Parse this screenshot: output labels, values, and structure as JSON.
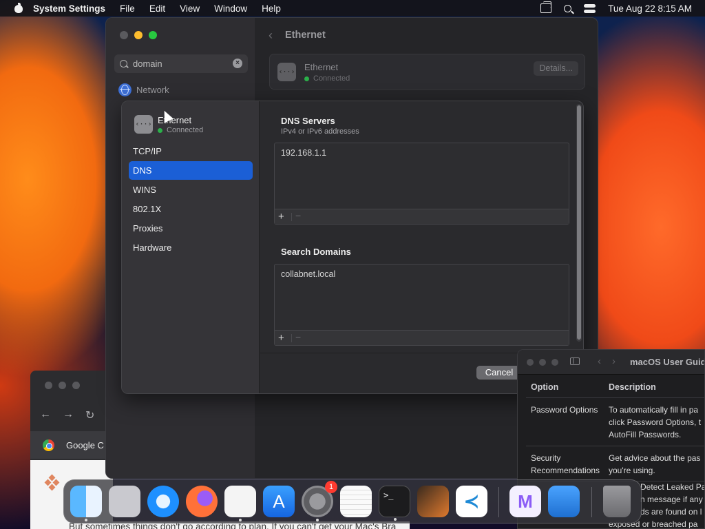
{
  "menubar": {
    "app_name": "System Settings",
    "menus": [
      "File",
      "Edit",
      "View",
      "Window",
      "Help"
    ],
    "datetime": "Tue Aug 22  8:15 AM"
  },
  "settings": {
    "search": {
      "value": "domain",
      "clear_icon": "clear-icon"
    },
    "sidebar_match": "Network",
    "header_title": "Ethernet",
    "ethernet_card": {
      "name": "Ethernet",
      "status": "Connected",
      "details_label": "Details..."
    }
  },
  "dns_sheet": {
    "interface": {
      "name": "Ethernet",
      "status": "Connected"
    },
    "nav": [
      "TCP/IP",
      "DNS",
      "WINS",
      "802.1X",
      "Proxies",
      "Hardware"
    ],
    "selected_nav": "DNS",
    "dns_servers": {
      "title": "DNS Servers",
      "subtitle": "IPv4 or IPv6 addresses",
      "entries": [
        "192.168.1.1"
      ]
    },
    "search_domains": {
      "title": "Search Domains",
      "entries": [
        "collabnet.local"
      ]
    },
    "add_label": "+",
    "remove_label": "−",
    "cancel_label": "Cancel"
  },
  "browser": {
    "tab_label": "Google C"
  },
  "help_window": {
    "title": "macOS User Guid",
    "columns": [
      "Option",
      "Description"
    ],
    "rows": [
      {
        "option": [
          "Password Options"
        ],
        "description": [
          "To automatically fill in pa",
          "click Password Options, t",
          "AutoFill Passwords."
        ]
      },
      {
        "option": [
          "Security",
          "Recommendations"
        ],
        "description": [
          "Get advice about the pas",
          "you're using."
        ]
      },
      {
        "option": [],
        "description": [
          "Detect Leaked Pa",
          "n message if any",
          "ds are found on l",
          "exposed or breached pa"
        ]
      }
    ]
  },
  "background_doc_text": "But sometimes things don't go according to plan. If you can't get your Mac's Bra",
  "dock": {
    "apps": [
      {
        "name": "Finder",
        "icon": "finder-icon",
        "color": "#2a8df2"
      },
      {
        "name": "Launchpad",
        "icon": "launchpad-icon",
        "color": "#d9d9de"
      },
      {
        "name": "Safari",
        "icon": "safari-icon",
        "color": "#1e90ff"
      },
      {
        "name": "Firefox",
        "icon": "firefox-icon",
        "color": "#ff7139"
      },
      {
        "name": "Chrome",
        "icon": "chrome-icon",
        "color": "#ffffff"
      },
      {
        "name": "App Store",
        "icon": "app-store-icon",
        "color": "#1a8cff"
      },
      {
        "name": "System Settings",
        "icon": "system-settings-icon",
        "color": "#8e8e93",
        "badge": "1"
      },
      {
        "name": "TextEdit",
        "icon": "textedit-icon",
        "color": "#f2f2f2"
      },
      {
        "name": "Terminal",
        "icon": "terminal-icon",
        "color": "#1c1c1e"
      },
      {
        "name": "GarageBand",
        "icon": "garageband-icon",
        "color": "#e07a2e"
      },
      {
        "name": "Visual Studio Code",
        "icon": "vscode-icon",
        "color": "#ffffff"
      },
      {
        "name": "Visual Studio",
        "icon": "visual-studio-icon",
        "color": "#f4f0ff"
      },
      {
        "name": "Weather",
        "icon": "weather-icon",
        "color": "#2f7bd8"
      },
      {
        "name": "Trash",
        "icon": "trash-icon",
        "color": "#8a8a8e"
      }
    ]
  }
}
